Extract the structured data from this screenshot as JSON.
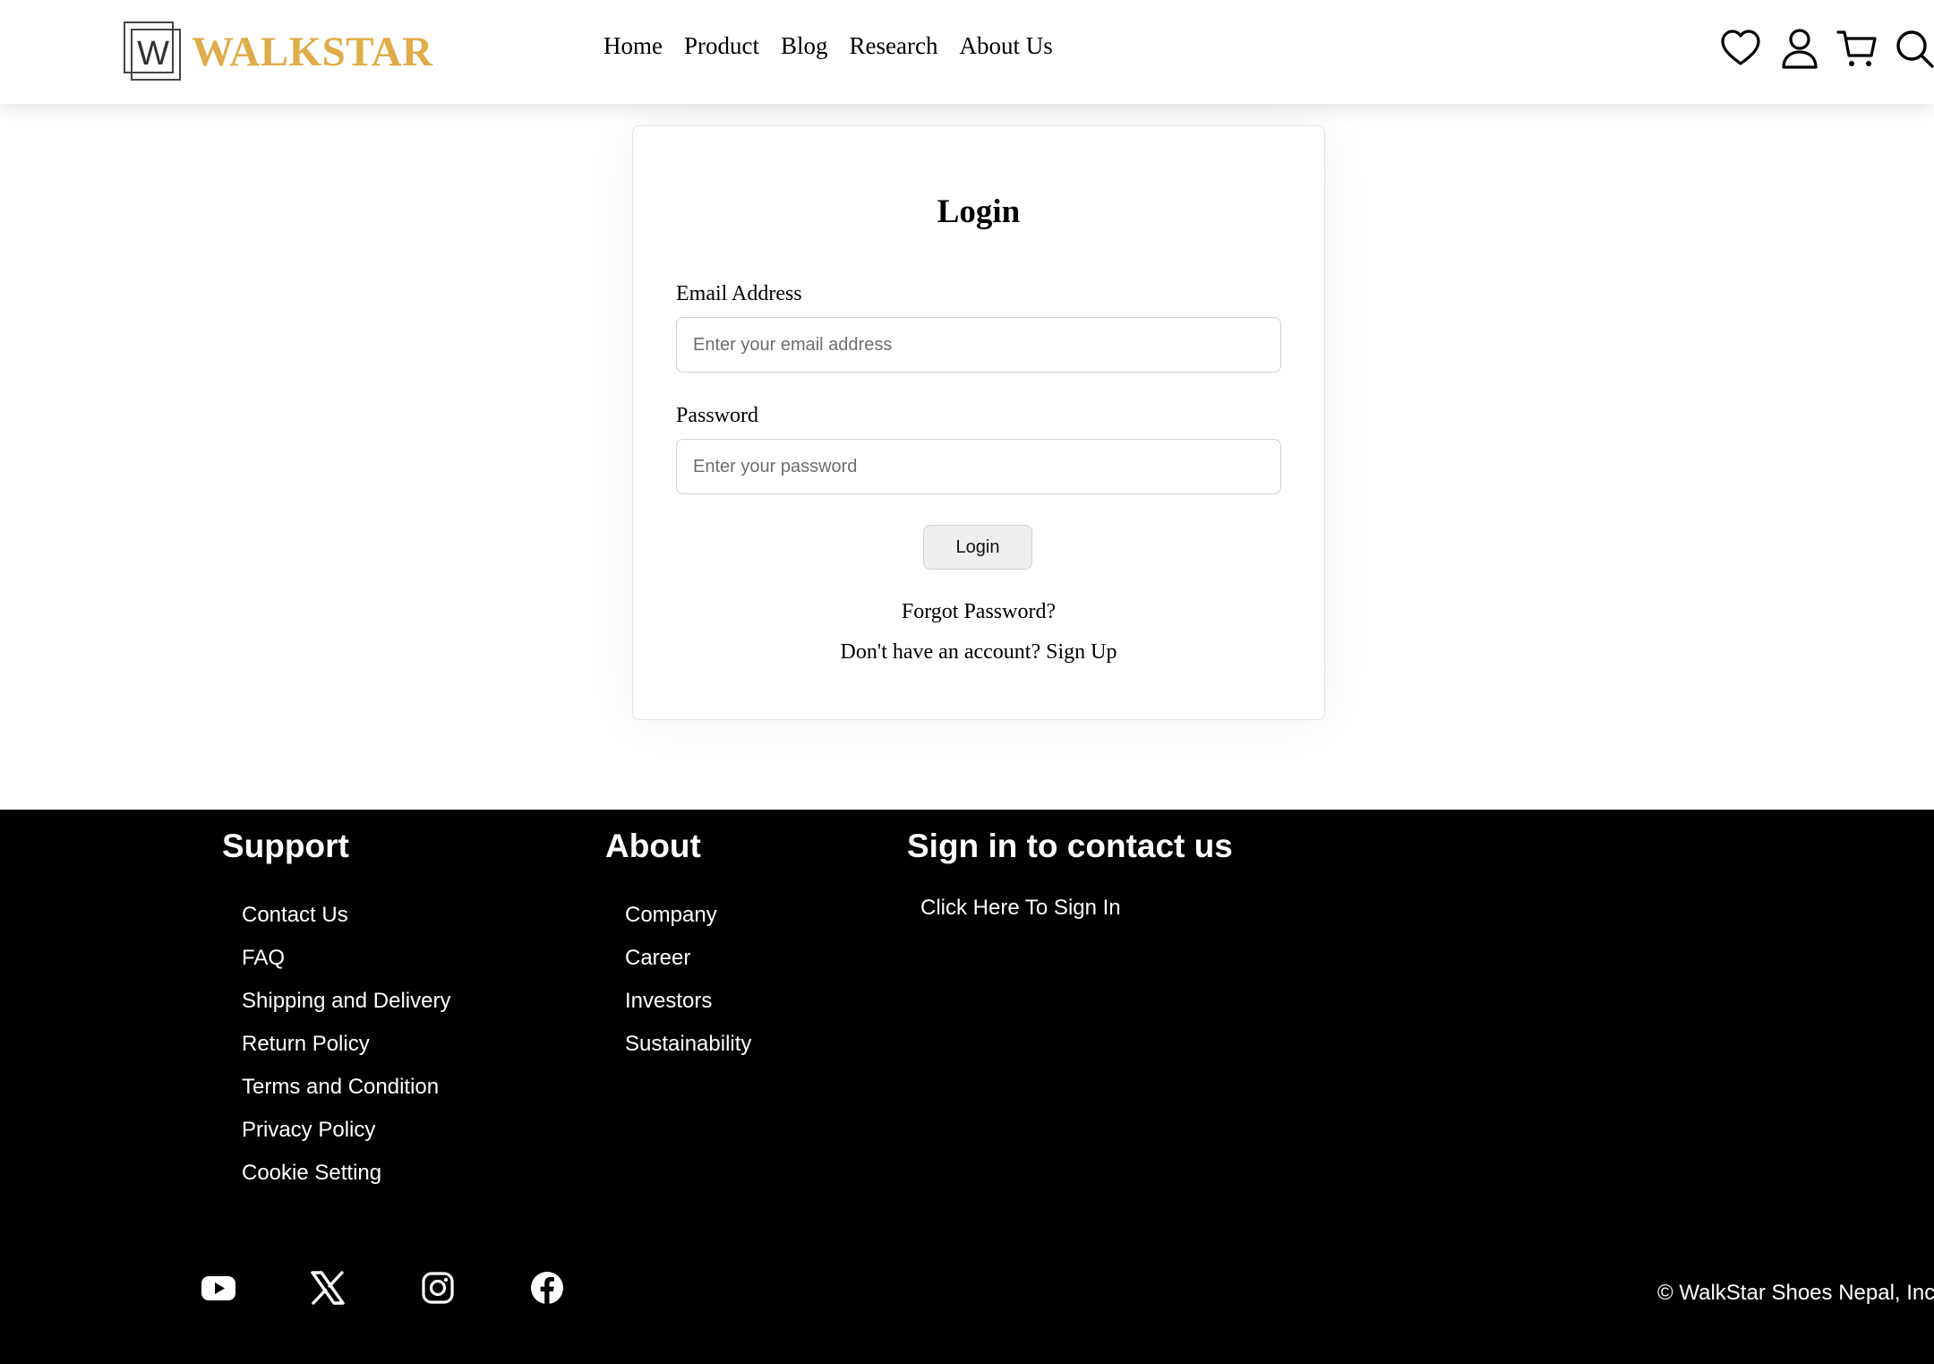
{
  "brand": {
    "logo_letter": "W",
    "name": "WALKSTAR",
    "accent_color": "#e0ac4a"
  },
  "nav": {
    "items": [
      {
        "label": "Home"
      },
      {
        "label": "Product"
      },
      {
        "label": "Blog"
      },
      {
        "label": "Research"
      },
      {
        "label": "About Us"
      }
    ]
  },
  "header_icons": [
    "heart-icon",
    "user-icon",
    "cart-icon",
    "search-icon"
  ],
  "login": {
    "title": "Login",
    "email_label": "Email Address",
    "email_placeholder": "Enter your email address",
    "email_value": "",
    "password_label": "Password",
    "password_placeholder": "Enter your password",
    "password_value": "",
    "button_label": "Login",
    "forgot_label": "Forgot Password?",
    "no_account_text": "Don't have an account?",
    "signup_label": "Sign Up"
  },
  "footer": {
    "support": {
      "title": "Support",
      "links": [
        "Contact Us",
        "FAQ",
        "Shipping and Delivery",
        "Return Policy",
        "Terms and Condition",
        "Privacy Policy",
        "Cookie Setting"
      ]
    },
    "about": {
      "title": "About",
      "links": [
        "Company",
        "Career",
        "Investors",
        "Sustainability"
      ]
    },
    "contact": {
      "title": "Sign in to contact us",
      "link": "Click Here To Sign In"
    },
    "social_icons": [
      "youtube-icon",
      "x-icon",
      "instagram-icon",
      "facebook-icon"
    ],
    "copyright": "© WalkStar Shoes Nepal, Inc"
  }
}
